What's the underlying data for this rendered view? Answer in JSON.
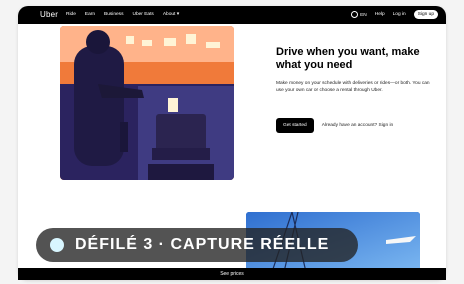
{
  "nav": {
    "logo": "Uber",
    "links": [
      "Ride",
      "Earn",
      "Business",
      "Uber Eats",
      "About"
    ],
    "lang": "EN",
    "help": "Help",
    "login": "Log in",
    "signup": "Sign up"
  },
  "hero": {
    "title": "Drive when you want, make what you need",
    "body": "Make money on your schedule with deliveries or rides—or both. You can use your own car or choose a rental through Uber.",
    "cta": "Get started",
    "signin": "Already have an account? Sign in"
  },
  "overlay": {
    "badge_text": "DÉFILÉ 3 · CAPTURE RÉELLE"
  },
  "bottom": {
    "see_prices": "See prices"
  },
  "colors": {
    "nav_bg": "#000000",
    "accent_orange": "#f07a3a",
    "sky_blue": "#1f5fbf"
  }
}
